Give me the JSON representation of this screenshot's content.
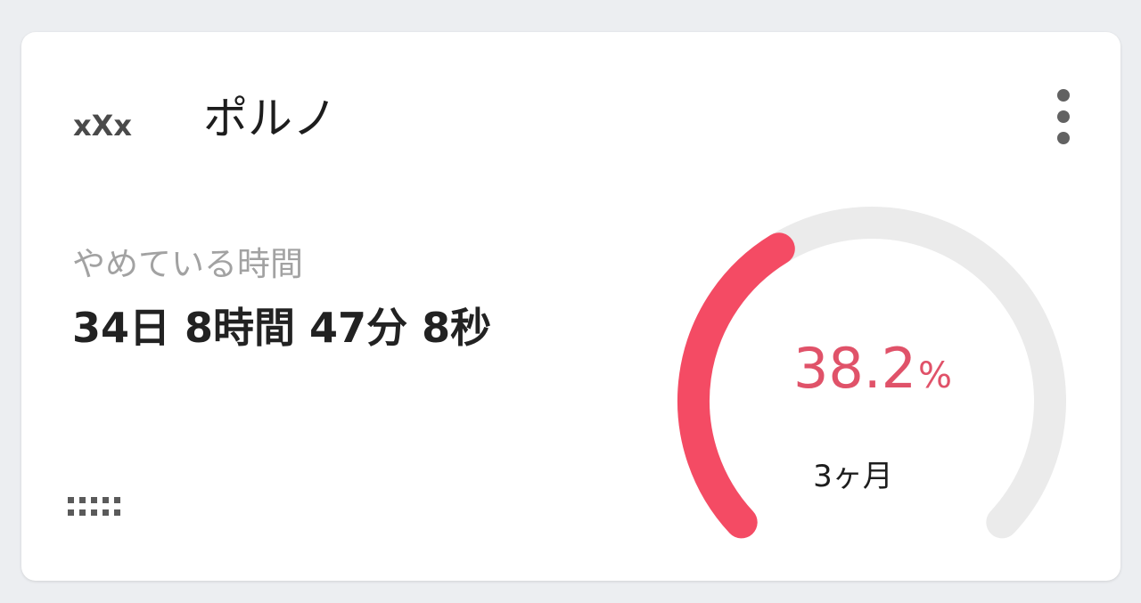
{
  "card": {
    "logo_text": "xXx",
    "logo_icon": "xxx-logo-icon",
    "title": "ポルノ",
    "menu_icon": "more-vert-icon"
  },
  "streak": {
    "label": "やめている時間",
    "elapsed": "34日 8時間 47分 8秒"
  },
  "progress": {
    "percent_value": "38.2",
    "percent_unit": "%",
    "fraction": 0.382,
    "goal_label": "3ヶ月"
  },
  "handle_icon": "drag-handle-icon",
  "colors": {
    "accent": "#f44b64",
    "percent_text": "#e05269",
    "track": "#ebebeb",
    "background": "#eceef1",
    "card": "#ffffff"
  }
}
